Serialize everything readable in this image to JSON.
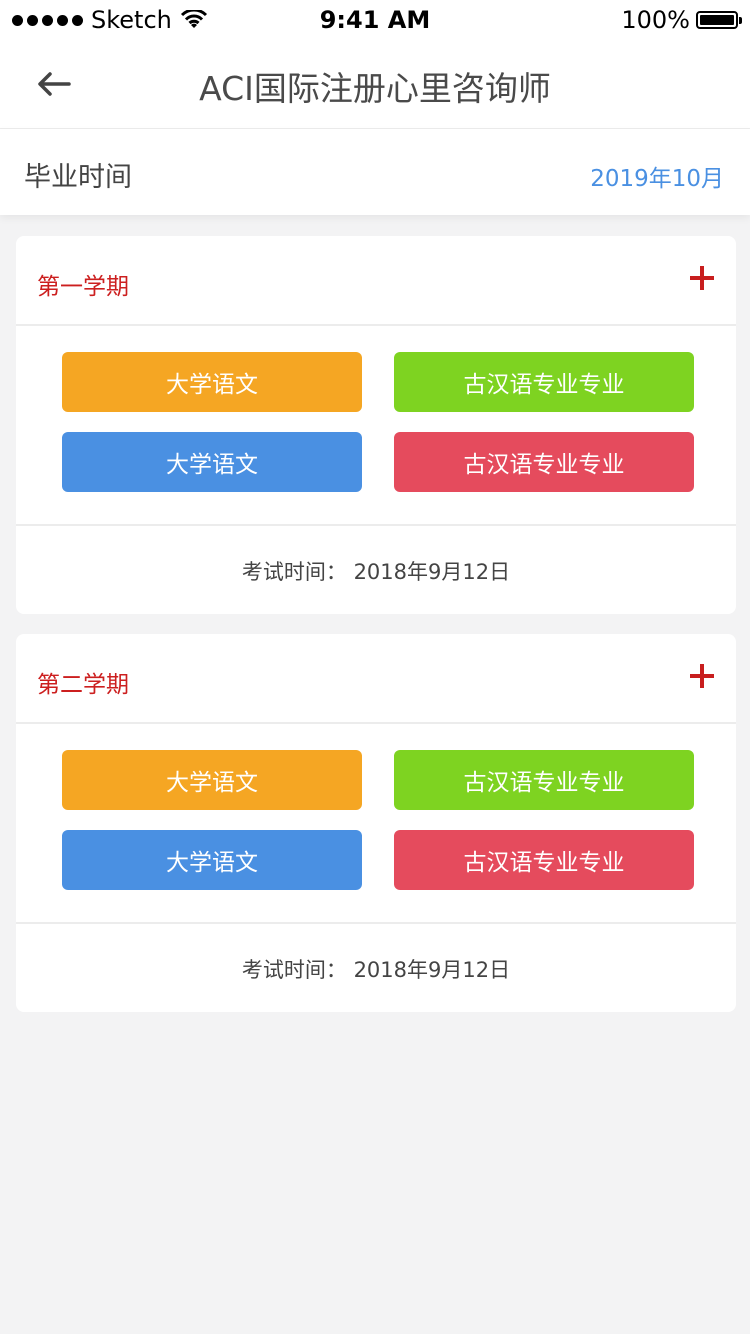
{
  "status_bar": {
    "carrier": "Sketch",
    "time": "9:41 AM",
    "battery": "100%"
  },
  "nav": {
    "title": "ACI国际注册心里咨询师",
    "back_icon": "arrow-left-icon"
  },
  "graduation": {
    "label": "毕业时间",
    "value": "2019年10月"
  },
  "semesters": [
    {
      "title": "第一学期",
      "courses": [
        {
          "label": "大学语文",
          "color": "#f5a623"
        },
        {
          "label": "古汉语专业专业",
          "color": "#7ed321"
        },
        {
          "label": "大学语文",
          "color": "#4a90e2"
        },
        {
          "label": "古汉语专业专业",
          "color": "#e54b5d"
        }
      ],
      "exam": "考试时间：  2018年9月12日"
    },
    {
      "title": "第二学期",
      "courses": [
        {
          "label": "大学语文",
          "color": "#f5a623"
        },
        {
          "label": "古汉语专业专业",
          "color": "#7ed321"
        },
        {
          "label": "大学语文",
          "color": "#4a90e2"
        },
        {
          "label": "古汉语专业专业",
          "color": "#e54b5d"
        }
      ],
      "exam": "考试时间：  2018年9月12日"
    }
  ],
  "colors": {
    "accent_blue": "#4a90e2",
    "semester_red": "#cc1f1f",
    "background": "#f3f3f4"
  }
}
